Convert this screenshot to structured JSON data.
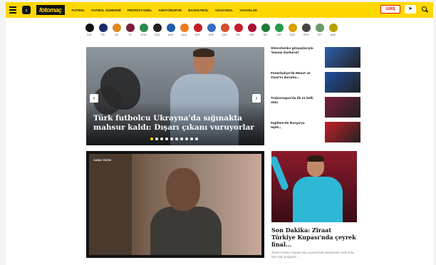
{
  "header": {
    "logo": "fotomaç",
    "nav": [
      "FUTBOL",
      "FUTBOL GÜNDEMİ",
      "PROFESYONEL",
      "AMATÖRSPOR",
      "BASKETBOL",
      "VOLEYBOL",
      "YAZARLAR"
    ],
    "login_label": "GİRİŞ",
    "colors": {
      "accent": "#ffd700",
      "login": "#dd1111"
    }
  },
  "teams": [
    {
      "code": "BJK",
      "color": "#111111"
    },
    {
      "code": "FB",
      "color": "#1a2a6c"
    },
    {
      "code": "GS",
      "color": "#e08a1e"
    },
    {
      "code": "TS",
      "color": "#7a1f3a"
    },
    {
      "code": "KON",
      "color": "#2a8a4a"
    },
    {
      "code": "GAZ",
      "color": "#222222"
    },
    {
      "code": "ADS",
      "color": "#1f5fa8"
    },
    {
      "code": "ALN",
      "color": "#f07a1a"
    },
    {
      "code": "ANT",
      "color": "#c41e2a"
    },
    {
      "code": "KAS",
      "color": "#3a6ec0"
    },
    {
      "code": "KAY",
      "color": "#d4502a"
    },
    {
      "code": "SİV",
      "color": "#c41e2a"
    },
    {
      "code": "HAT",
      "color": "#a8123a"
    },
    {
      "code": "RİZ",
      "color": "#1f7a3a"
    },
    {
      "code": "GİR",
      "color": "#2a9a4a"
    },
    {
      "code": "GÖZ",
      "color": "#d8a000"
    },
    {
      "code": "PEN",
      "color": "#444444"
    },
    {
      "code": "İST",
      "color": "#6a9a6a"
    },
    {
      "code": "ANK",
      "color": "#b8a000"
    }
  ],
  "slider": {
    "headline": "Türk futbolcu Ukrayna'da sığınakta mahsur kaldı: Dışarı çıkanı vuruyorlar",
    "dot_count": 10,
    "active_index": 0
  },
  "news": [
    {
      "title": "Shevchenko gözyaşlarıyla 'Savaşı durdurun'",
      "thumb_color": "#2f5fb0"
    },
    {
      "title": "Fenerbahçe'de Mesut ve Ozan'ın durumu...",
      "thumb_color": "#1f4fa0"
    },
    {
      "title": "Trabzonspor'da ilk 11 belli oldu",
      "thumb_color": "#7a1f3a"
    },
    {
      "title": "İngiltere'de Rusya'ya tepki...",
      "thumb_color": "#c41e2a"
    }
  ],
  "video": {
    "overlay_label": "CANLI YAYIN"
  },
  "feature": {
    "title": "Son Dakika: Ziraat Türkiye Kupası'nda çeyrek final...",
    "desc": "Ziraat Türkiye Kupası'nda çeyrek final eşleşmeleri belli oldu. İşte maç programı..."
  }
}
